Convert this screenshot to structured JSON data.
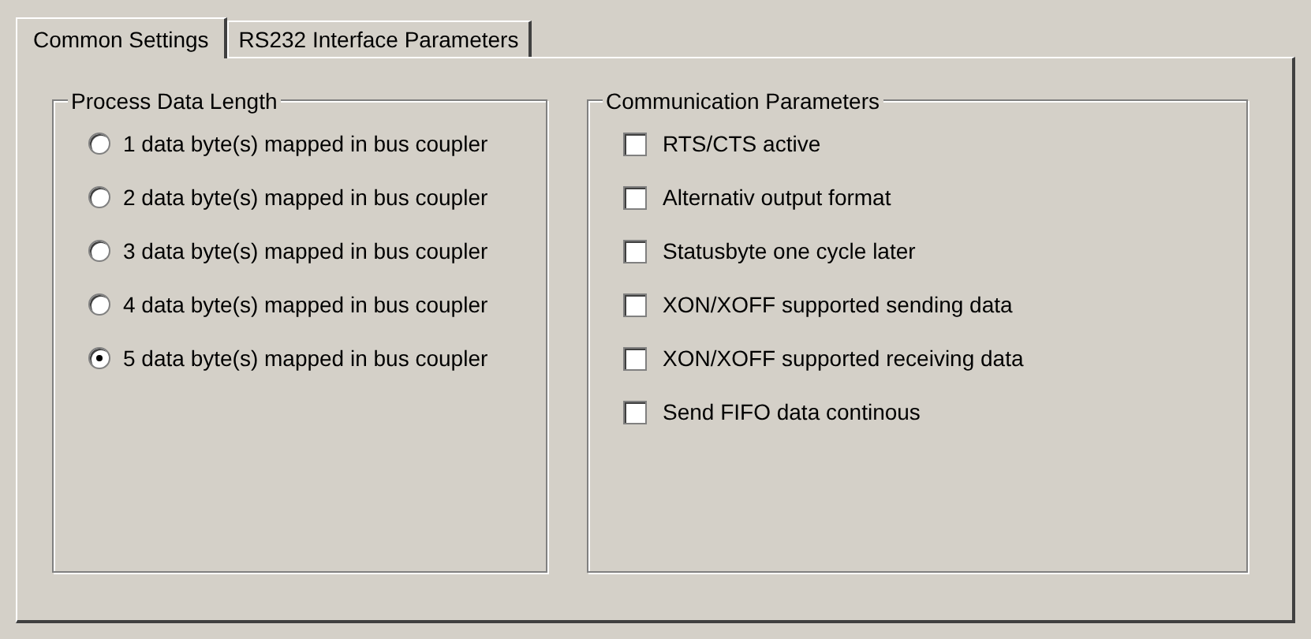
{
  "tabs": [
    {
      "label": "Common Settings",
      "selected": true
    },
    {
      "label": "RS232 Interface Parameters",
      "selected": false
    }
  ],
  "process_data_length": {
    "title": "Process Data Length",
    "options": [
      {
        "label": "1 data byte(s) mapped in bus coupler",
        "selected": false
      },
      {
        "label": "2 data byte(s) mapped in bus coupler",
        "selected": false
      },
      {
        "label": "3 data byte(s) mapped in bus coupler",
        "selected": false
      },
      {
        "label": "4 data byte(s) mapped in bus coupler",
        "selected": false
      },
      {
        "label": "5 data byte(s) mapped in bus coupler",
        "selected": true
      }
    ]
  },
  "communication_parameters": {
    "title": "Communication Parameters",
    "options": [
      {
        "label": "RTS/CTS active",
        "checked": false
      },
      {
        "label": "Alternativ output format",
        "checked": false
      },
      {
        "label": "Statusbyte one cycle later",
        "checked": false
      },
      {
        "label": "XON/XOFF supported sending data",
        "checked": false
      },
      {
        "label": "XON/XOFF supported receiving data",
        "checked": false
      },
      {
        "label": "Send FIFO data continous",
        "checked": false
      }
    ]
  }
}
